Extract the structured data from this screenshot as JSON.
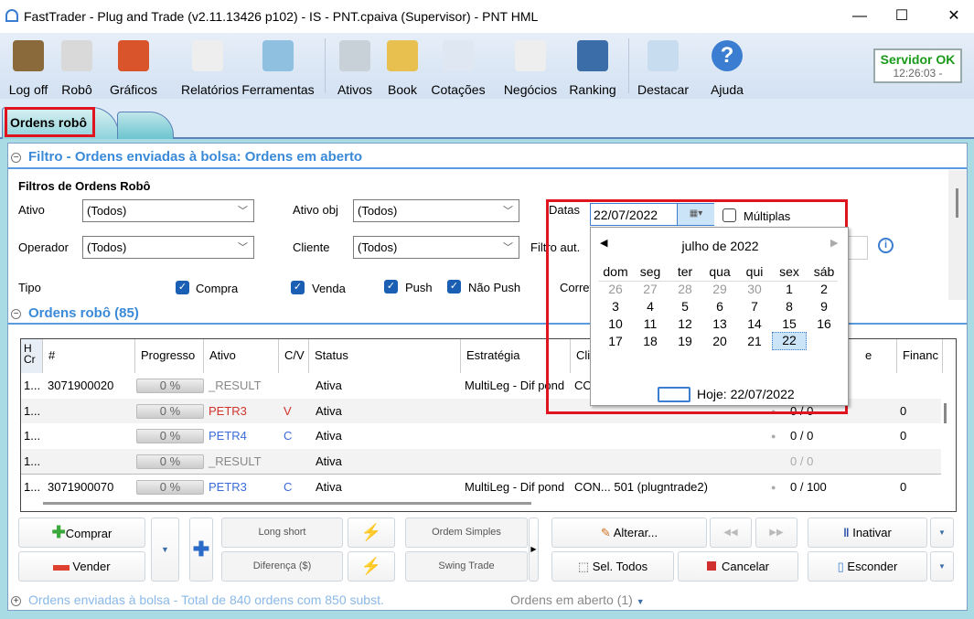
{
  "window": {
    "title": "FastTrader - Plug and Trade (v2.11.13426 p102) - IS - PNT.cpaiva (Supervisor) - PNT HML",
    "minimize": "—",
    "maximize": "☐",
    "close": "✕"
  },
  "toolbar": {
    "items": [
      {
        "label": "Log off",
        "icon": "users-icon",
        "color": "#8a6a3a"
      },
      {
        "label": "Robô",
        "icon": "robot-icon",
        "color": "#d9d9d9"
      },
      {
        "label": "Gráficos",
        "icon": "chart-mountain-icon",
        "color": "#d9542b"
      },
      {
        "label": "Relatórios",
        "icon": "report-icon",
        "color": "#eeeeee"
      },
      {
        "label": "Ferramentas",
        "icon": "gears-icon",
        "color": "#8fc0e0"
      },
      {
        "label": "Ativos",
        "icon": "card-file-icon",
        "color": "#c8d0d8"
      },
      {
        "label": "Book",
        "icon": "book-grid-icon",
        "color": "#e8c050"
      },
      {
        "label": "Cotações",
        "icon": "table-icon",
        "color": "#dfe8f2"
      },
      {
        "label": "Negócios",
        "icon": "documents-icon",
        "color": "#eeeeee"
      },
      {
        "label": "Ranking",
        "icon": "bar-chart-icon",
        "color": "#3b6ea8"
      },
      {
        "label": "Destacar",
        "icon": "detach-window-icon",
        "color": "#c8dcf0"
      },
      {
        "label": "Ajuda",
        "icon": "help-icon",
        "color": "#3b7dd0"
      }
    ],
    "server_status": "Servidor OK",
    "server_time": "12:26:03 -"
  },
  "tabs": [
    {
      "label": "Ordens robô",
      "active": true
    },
    {
      "label": ""
    }
  ],
  "filter": {
    "section_title": "Filtro - Ordens enviadas à bolsa: Ordens em aberto",
    "heading": "Filtros de Ordens Robô",
    "ativo_label": "Ativo",
    "ativo_value": "(Todos)",
    "ativo_obj_label": "Ativo obj",
    "ativo_obj_value": "(Todos)",
    "operador_label": "Operador",
    "operador_value": "(Todos)",
    "cliente_label": "Cliente",
    "cliente_value": "(Todos)",
    "datas_label": "Datas",
    "datas_value": "22/07/2022",
    "multiplas_label": "Múltiplas",
    "multiplas_checked": false,
    "filtro_aut_label": "Filtro aut.",
    "corret_label": "Corret",
    "tipo_label": "Tipo",
    "checks": [
      {
        "label": "Compra",
        "checked": true
      },
      {
        "label": "Venda",
        "checked": true
      },
      {
        "label": "Push",
        "checked": true
      },
      {
        "label": "Não Push",
        "checked": true
      }
    ]
  },
  "calendar": {
    "month": "julho de 2022",
    "weekdays": [
      "dom",
      "seg",
      "ter",
      "qua",
      "qui",
      "sex",
      "sáb"
    ],
    "weeks": [
      [
        "26",
        "27",
        "28",
        "29",
        "30",
        "1",
        "2"
      ],
      [
        "3",
        "4",
        "5",
        "6",
        "7",
        "8",
        "9"
      ],
      [
        "10",
        "11",
        "12",
        "13",
        "14",
        "15",
        "16"
      ],
      [
        "17",
        "18",
        "19",
        "20",
        "21",
        "22",
        ""
      ]
    ],
    "selected": "22",
    "today_label": "Hoje: 22/07/2022"
  },
  "orders": {
    "section_title": "Ordens robô (85)",
    "columns": [
      "H Cr",
      "#",
      "Progresso",
      "Ativo",
      "C/V",
      "Status",
      "Estratégia",
      "Cli",
      "e",
      "Financ"
    ],
    "rows": [
      {
        "h": "1...",
        "id": "3071900020",
        "prog": "0 %",
        "ativo": "_RESULT",
        "cv": "",
        "status": "Ativa",
        "estrategia": "MultiLeg - Dif pond",
        "cli": "CO",
        "qtd": "",
        "fin": ""
      },
      {
        "h": "1...",
        "id": "",
        "prog": "0 %",
        "ativo": "PETR3",
        "cv": "V",
        "status": "Ativa",
        "estrategia": "",
        "cli": "",
        "qtd": "0 / 0",
        "fin": "0"
      },
      {
        "h": "1...",
        "id": "",
        "prog": "0 %",
        "ativo": "PETR4",
        "cv": "C",
        "status": "Ativa",
        "estrategia": "",
        "cli": "",
        "qtd": "0 / 0",
        "fin": "0"
      },
      {
        "h": "1...",
        "id": "",
        "prog": "0 %",
        "ativo": "_RESULT",
        "cv": "",
        "status": "Ativa",
        "estrategia": "",
        "cli": "",
        "qtd": "0 / 0",
        "fin": ""
      },
      {
        "h": "1...",
        "id": "3071900070",
        "prog": "0 %",
        "ativo": "PETR3",
        "cv": "C",
        "status": "Ativa",
        "estrategia": "MultiLeg - Dif pond",
        "cli": "CON...  501 (plugntrade2)",
        "qtd": "0 / 100",
        "fin": "0"
      }
    ]
  },
  "actions": {
    "comprar": "Comprar",
    "vender": "Vender",
    "long_short": "Long short",
    "diferenca": "Diferença ($)",
    "ordem_simples": "Ordem Simples",
    "swing_trade": "Swing Trade",
    "alterar": "Alterar...",
    "sel_todos": "Sel. Todos",
    "cancelar": "Cancelar",
    "inativar": "Inativar",
    "esconder": "Esconder"
  },
  "footer": {
    "summary": "Ordens enviadas à bolsa - Total de 840 ordens com 850 subst.",
    "dropdown": "Ordens em aberto (1)"
  },
  "colors": {
    "accent": "#3b8ad8",
    "sell": "#d0342c",
    "buy": "#3a6bd8",
    "server_ok": "#1a9a1a",
    "highlight": "#e0141e"
  }
}
